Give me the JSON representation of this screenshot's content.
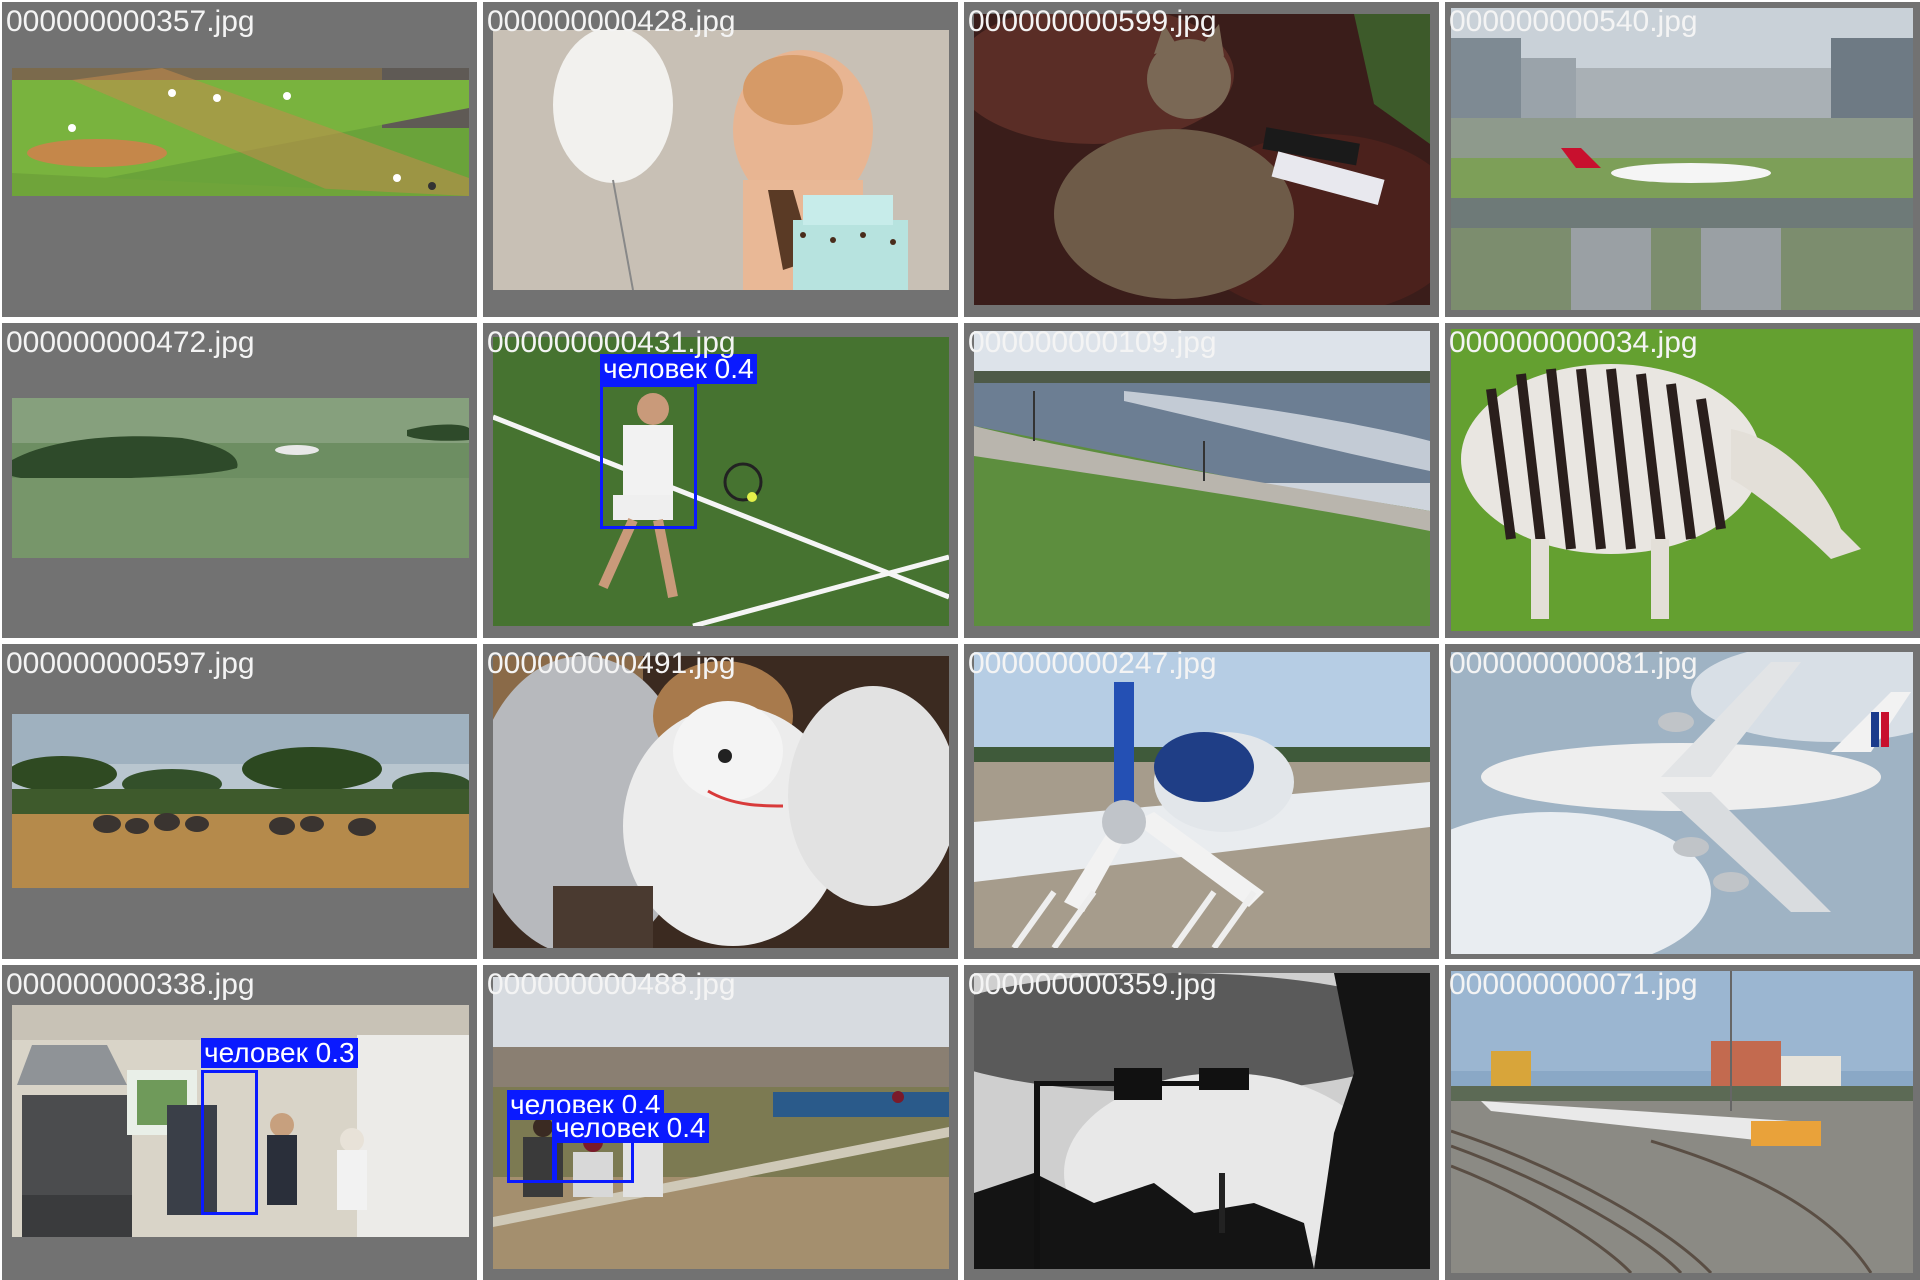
{
  "mosaic": {
    "tiles": [
      {
        "filename": "000000000357.jpg",
        "scene": "baseball-field"
      },
      {
        "filename": "000000000428.jpg",
        "scene": "toddler-birthday-cake"
      },
      {
        "filename": "000000000599.jpg",
        "scene": "cat-on-leather-couch"
      },
      {
        "filename": "000000000540.jpg",
        "scene": "airport-jet-highway"
      },
      {
        "filename": "000000000472.jpg",
        "scene": "plane-over-lake-island"
      },
      {
        "filename": "000000000431.jpg",
        "scene": "tennis-player",
        "detections": [
          {
            "label": "человек 0.4",
            "class": "человек",
            "confidence": 0.4
          }
        ]
      },
      {
        "filename": "000000000109.jpg",
        "scene": "riverside-park"
      },
      {
        "filename": "000000000034.jpg",
        "scene": "zebra-grazing"
      },
      {
        "filename": "000000000597.jpg",
        "scene": "savanna-elephants"
      },
      {
        "filename": "000000000491.jpg",
        "scene": "white-teddy-bear"
      },
      {
        "filename": "000000000247.jpg",
        "scene": "small-propeller-plane"
      },
      {
        "filename": "000000000081.jpg",
        "scene": "air-france-a380"
      },
      {
        "filename": "000000000338.jpg",
        "scene": "kitchen-people",
        "detections": [
          {
            "label": "человек 0.3",
            "class": "человек",
            "confidence": 0.3
          }
        ]
      },
      {
        "filename": "000000000488.jpg",
        "scene": "baseball-game",
        "detections": [
          {
            "label": "человек 0.4",
            "class": "человек",
            "confidence": 0.4
          },
          {
            "label": "человек 0.4",
            "class": "человек",
            "confidence": 0.4
          }
        ]
      },
      {
        "filename": "000000000359.jpg",
        "scene": "silhouette-traffic-light"
      },
      {
        "filename": "000000000071.jpg",
        "scene": "railway-yard-train"
      }
    ]
  },
  "colors": {
    "tile_background": "#727272",
    "filename_text": "#f4f4f4",
    "detection_box": "#0a1aff",
    "detection_label_text": "#ffffff"
  }
}
